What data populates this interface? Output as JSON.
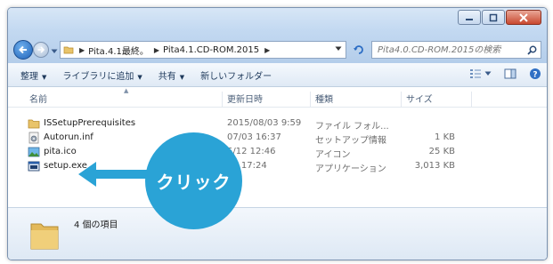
{
  "breadcrumb": [
    "Pita.4.1最終。",
    "Pita4.1.CD-ROM.2015"
  ],
  "search": {
    "placeholder": "Pita4.0.CD-ROM.2015の検索"
  },
  "toolbar": {
    "organize": "整理",
    "add_to_library": "ライブラリに追加",
    "share": "共有",
    "new_folder": "新しいフォルダー"
  },
  "columns": {
    "name": "名前",
    "date": "更新日時",
    "type": "種類",
    "size": "サイズ"
  },
  "files": [
    {
      "icon": "folder-icon",
      "name": "ISSetupPrerequisites",
      "date": "2015/08/03 9:59",
      "type": "ファイル フォル...",
      "size": ""
    },
    {
      "icon": "setup-info-file-icon",
      "name": "Autorun.inf",
      "date": "07/03 16:37",
      "type": "セットアップ情報",
      "size": "1 KB"
    },
    {
      "icon": "image-file-icon",
      "name": "pita.ico",
      "date": "5/12 12:46",
      "type": "アイコン",
      "size": "25 KB"
    },
    {
      "icon": "application-exe-icon",
      "name": "setup.exe",
      "date": "31 17:24",
      "type": "アプリケーション",
      "size": "3,013 KB"
    }
  ],
  "details": {
    "count": "4 個の項目"
  },
  "callout": {
    "text": "クリック",
    "color": "#2aa3d6"
  }
}
